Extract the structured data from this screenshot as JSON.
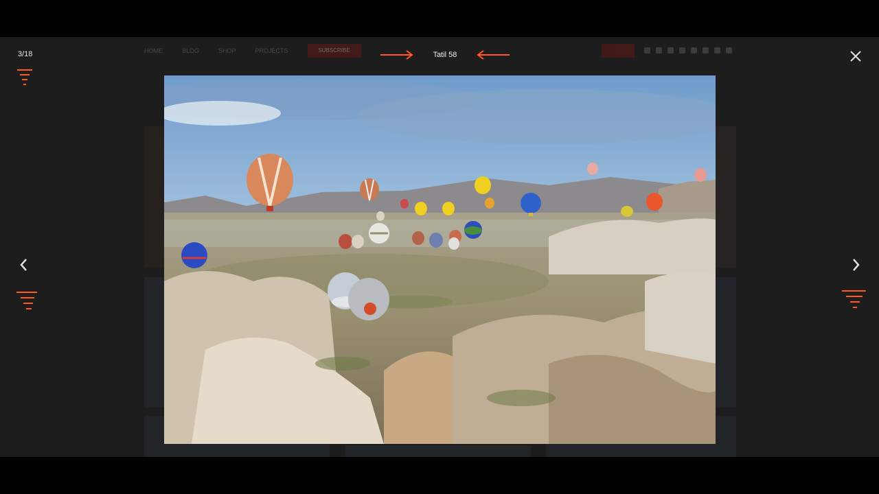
{
  "lightbox": {
    "counter": "3/18",
    "caption": "Tatil 58",
    "close_icon": "close-icon",
    "prev_icon": "chevron-left-icon",
    "next_icon": "chevron-right-icon",
    "accent_color": "#ff5a1f",
    "image_description_icon": "hot-air-balloons-photo"
  },
  "background_site": {
    "nav_items": [
      "HOME",
      "BLOG",
      "SHOP",
      "PROJECTS"
    ],
    "subscribe_label": "SUBSCRIBE"
  }
}
